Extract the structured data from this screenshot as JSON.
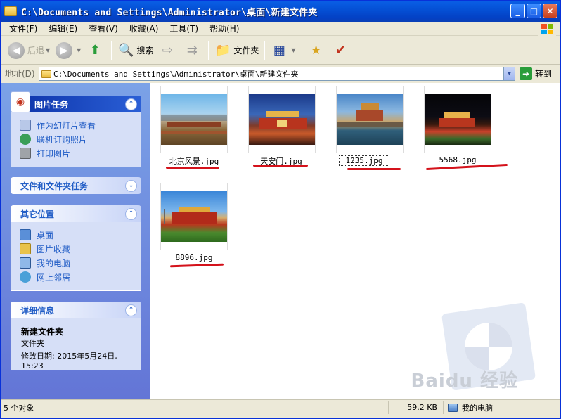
{
  "window": {
    "title": "C:\\Documents and Settings\\Administrator\\桌面\\新建文件夹",
    "buttons": {
      "minimize": "_",
      "maximize": "□",
      "close": "✕"
    }
  },
  "menu": [
    "文件(F)",
    "编辑(E)",
    "查看(V)",
    "收藏(A)",
    "工具(T)",
    "帮助(H)"
  ],
  "toolbar": {
    "back": "后退",
    "search": "搜索",
    "folders": "文件夹"
  },
  "address": {
    "label": "地址(D)",
    "path": "C:\\Documents and Settings\\Administrator\\桌面\\新建文件夹",
    "go": "转到"
  },
  "tasks": {
    "picture_tasks": {
      "title": "图片任务",
      "items": [
        "作为幻灯片查看",
        "联机订购照片",
        "打印图片"
      ]
    },
    "file_tasks": {
      "title": "文件和文件夹任务"
    },
    "other_places": {
      "title": "其它位置",
      "items": [
        "桌面",
        "图片收藏",
        "我的电脑",
        "网上邻居"
      ]
    },
    "details": {
      "title": "详细信息",
      "name": "新建文件夹",
      "type": "文件夹",
      "modified_label": "修改日期: 2015年5月24日,",
      "modified_time": "15:23"
    }
  },
  "files": [
    {
      "name": "北京风景.jpg"
    },
    {
      "name": "天安门.jpg"
    },
    {
      "name": "1235.jpg",
      "selected": true
    },
    {
      "name": "5568.jpg"
    },
    {
      "name": "8896.jpg"
    }
  ],
  "watermark": {
    "text": "Baidu 经验"
  },
  "status": {
    "count": "5 个对象",
    "size": "59.2 KB",
    "location": "我的电脑"
  },
  "colors": {
    "titlebar": "#0551d6",
    "taskpane": "#6f8ddf",
    "link": "#215dc6",
    "annotation_underline": "#d4121b"
  }
}
